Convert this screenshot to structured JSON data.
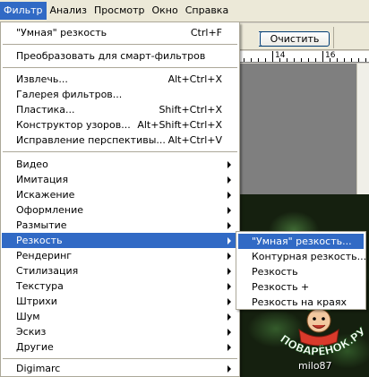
{
  "menubar": {
    "items": [
      "Фильтр",
      "Анализ",
      "Просмотр",
      "Окно",
      "Справка"
    ]
  },
  "toolbar": {
    "reset_button": "Очистить"
  },
  "ruler": {
    "labels": [
      "14",
      "16"
    ]
  },
  "filter_menu": {
    "last_filter": {
      "label": "\"Умная\" резкость",
      "shortcut": "Ctrl+F"
    },
    "convert_smart": "Преобразовать для смарт-фильтров",
    "extract": {
      "label": "Извлечь...",
      "shortcut": "Alt+Ctrl+X"
    },
    "gallery": {
      "label": "Галерея фильтров..."
    },
    "liquify": {
      "label": "Пластика...",
      "shortcut": "Shift+Ctrl+X"
    },
    "pattern_maker": {
      "label": "Конструктор узоров...",
      "shortcut": "Alt+Shift+Ctrl+X"
    },
    "vanishing_point": {
      "label": "Исправление перспективы...",
      "shortcut": "Alt+Ctrl+V"
    },
    "categories": [
      "Видео",
      "Имитация",
      "Искажение",
      "Оформление",
      "Размытие",
      "Резкость",
      "Рендеринг",
      "Стилизация",
      "Текстура",
      "Штрихи",
      "Шум",
      "Эскиз",
      "Другие"
    ],
    "digimarc": "Digimarc"
  },
  "sharpen_submenu": {
    "items": [
      "\"Умная\" резкость...",
      "Контурная резкость...",
      "Резкость",
      "Резкость +",
      "Резкость на краях"
    ]
  },
  "watermark": {
    "logo_text": "ПОВАРЁНОК.РУ",
    "author": "milo87"
  },
  "colors": {
    "highlight": "#316ac5",
    "menu_bg": "#ffffff",
    "chrome": "#ece9d8"
  }
}
